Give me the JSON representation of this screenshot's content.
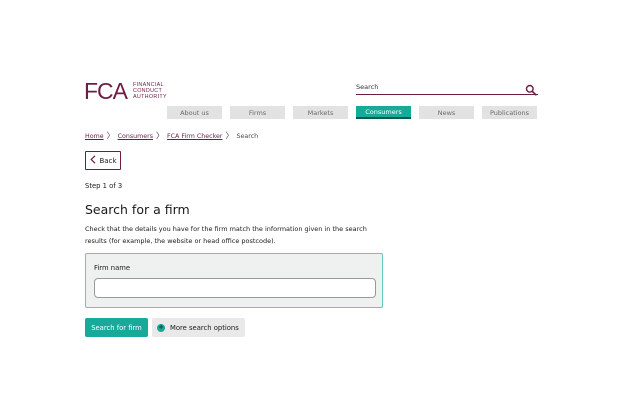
{
  "logo": {
    "mark": "FCA",
    "line1": "FINANCIAL",
    "line2": "CONDUCT",
    "line3": "AUTHORITY"
  },
  "header_search": {
    "placeholder": "Search",
    "icon": "search-icon"
  },
  "nav": {
    "items": [
      {
        "label": "About us"
      },
      {
        "label": "Firms"
      },
      {
        "label": "Markets"
      },
      {
        "label": "Consumers"
      },
      {
        "label": "News"
      },
      {
        "label": "Publications"
      }
    ],
    "active_index": 3
  },
  "breadcrumb": {
    "items": [
      {
        "label": "Home"
      },
      {
        "label": "Consumers"
      },
      {
        "label": "FCA Firm Checker"
      }
    ],
    "current": "Search",
    "separator": "〉"
  },
  "back_button": {
    "label": "Back",
    "icon": "chevron-left-icon"
  },
  "step": "Step 1 of 3",
  "page_title": "Search for a firm",
  "description": "Check that the details you have for the firm match the information given in the search results (for example, the website or head office postcode).",
  "form": {
    "field_label": "Firm name",
    "field_value": ""
  },
  "actions": {
    "search_label": "Search for firm",
    "more_label": "More search options",
    "more_icon": "plus-icon"
  },
  "colors": {
    "brand": "#6b1d45",
    "accent": "#17a99a",
    "nav_bg": "#e2e2e2",
    "panel_bg": "#eff0f0"
  }
}
